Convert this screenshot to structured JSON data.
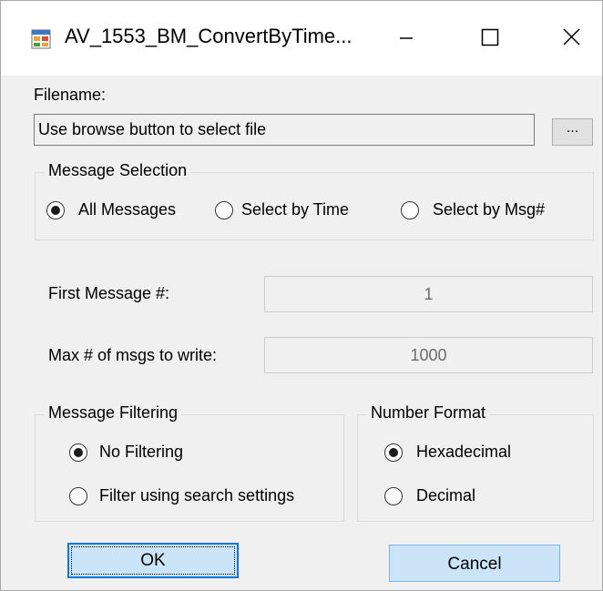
{
  "window": {
    "title": "AV_1553_BM_ConvertByTime...",
    "icon": "app-form-icon"
  },
  "titlebar_buttons": [
    "minimize-icon",
    "maximize-icon",
    "close-icon"
  ],
  "filename": {
    "label": "Filename:",
    "value": "Use browse button to select file",
    "browse_label": "..."
  },
  "message_selection": {
    "title": "Message Selection",
    "options": [
      {
        "label": "All Messages",
        "checked": true
      },
      {
        "label": "Select by Time",
        "checked": false
      },
      {
        "label": "Select by Msg#",
        "checked": false
      }
    ]
  },
  "first_message": {
    "label": "First Message #:",
    "value": "1"
  },
  "max_msgs": {
    "label": "Max # of msgs to write:",
    "value": "1000"
  },
  "message_filtering": {
    "title": "Message Filtering",
    "options": [
      {
        "label": "No Filtering",
        "checked": true
      },
      {
        "label": "Filter using search settings",
        "checked": false
      }
    ]
  },
  "number_format": {
    "title": "Number Format",
    "options": [
      {
        "label": "Hexadecimal",
        "checked": true
      },
      {
        "label": "Decimal",
        "checked": false
      }
    ]
  },
  "buttons": {
    "ok": "OK",
    "cancel": "Cancel"
  },
  "colors": {
    "window_bg": "#f0f0f0",
    "button_blue": "#cce4f7",
    "focus_border": "#0078d7"
  }
}
